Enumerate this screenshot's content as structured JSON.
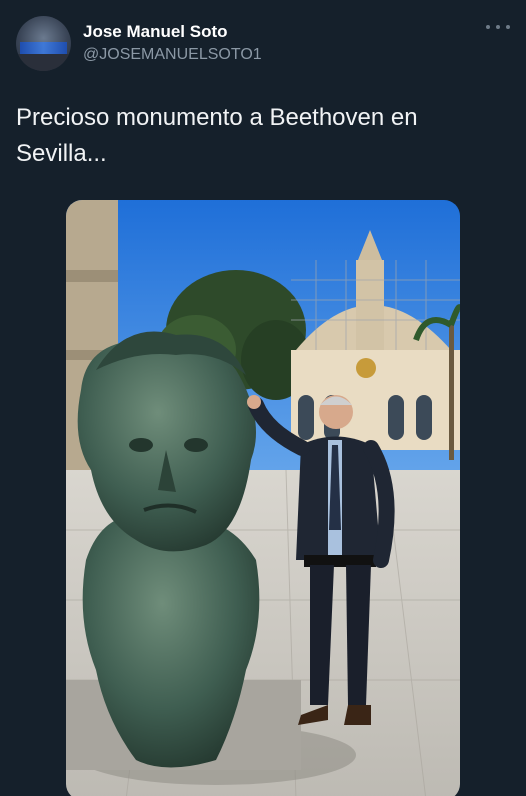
{
  "author": {
    "display_name": "Jose Manuel Soto",
    "handle": "@JOSEMANUELSOTO1",
    "avatar_icon": "profile-avatar-icon"
  },
  "menu": {
    "icon": "more-options-icon"
  },
  "tweet": {
    "text": "Precioso monumento a Beethoven en\nSevilla..."
  },
  "media": {
    "icon": "photo-image",
    "colors": {
      "sky": "#2f7fe3",
      "statue": "#3d5a4e",
      "building": "#e9dcc3",
      "pavement": "#cfcdc7"
    }
  }
}
